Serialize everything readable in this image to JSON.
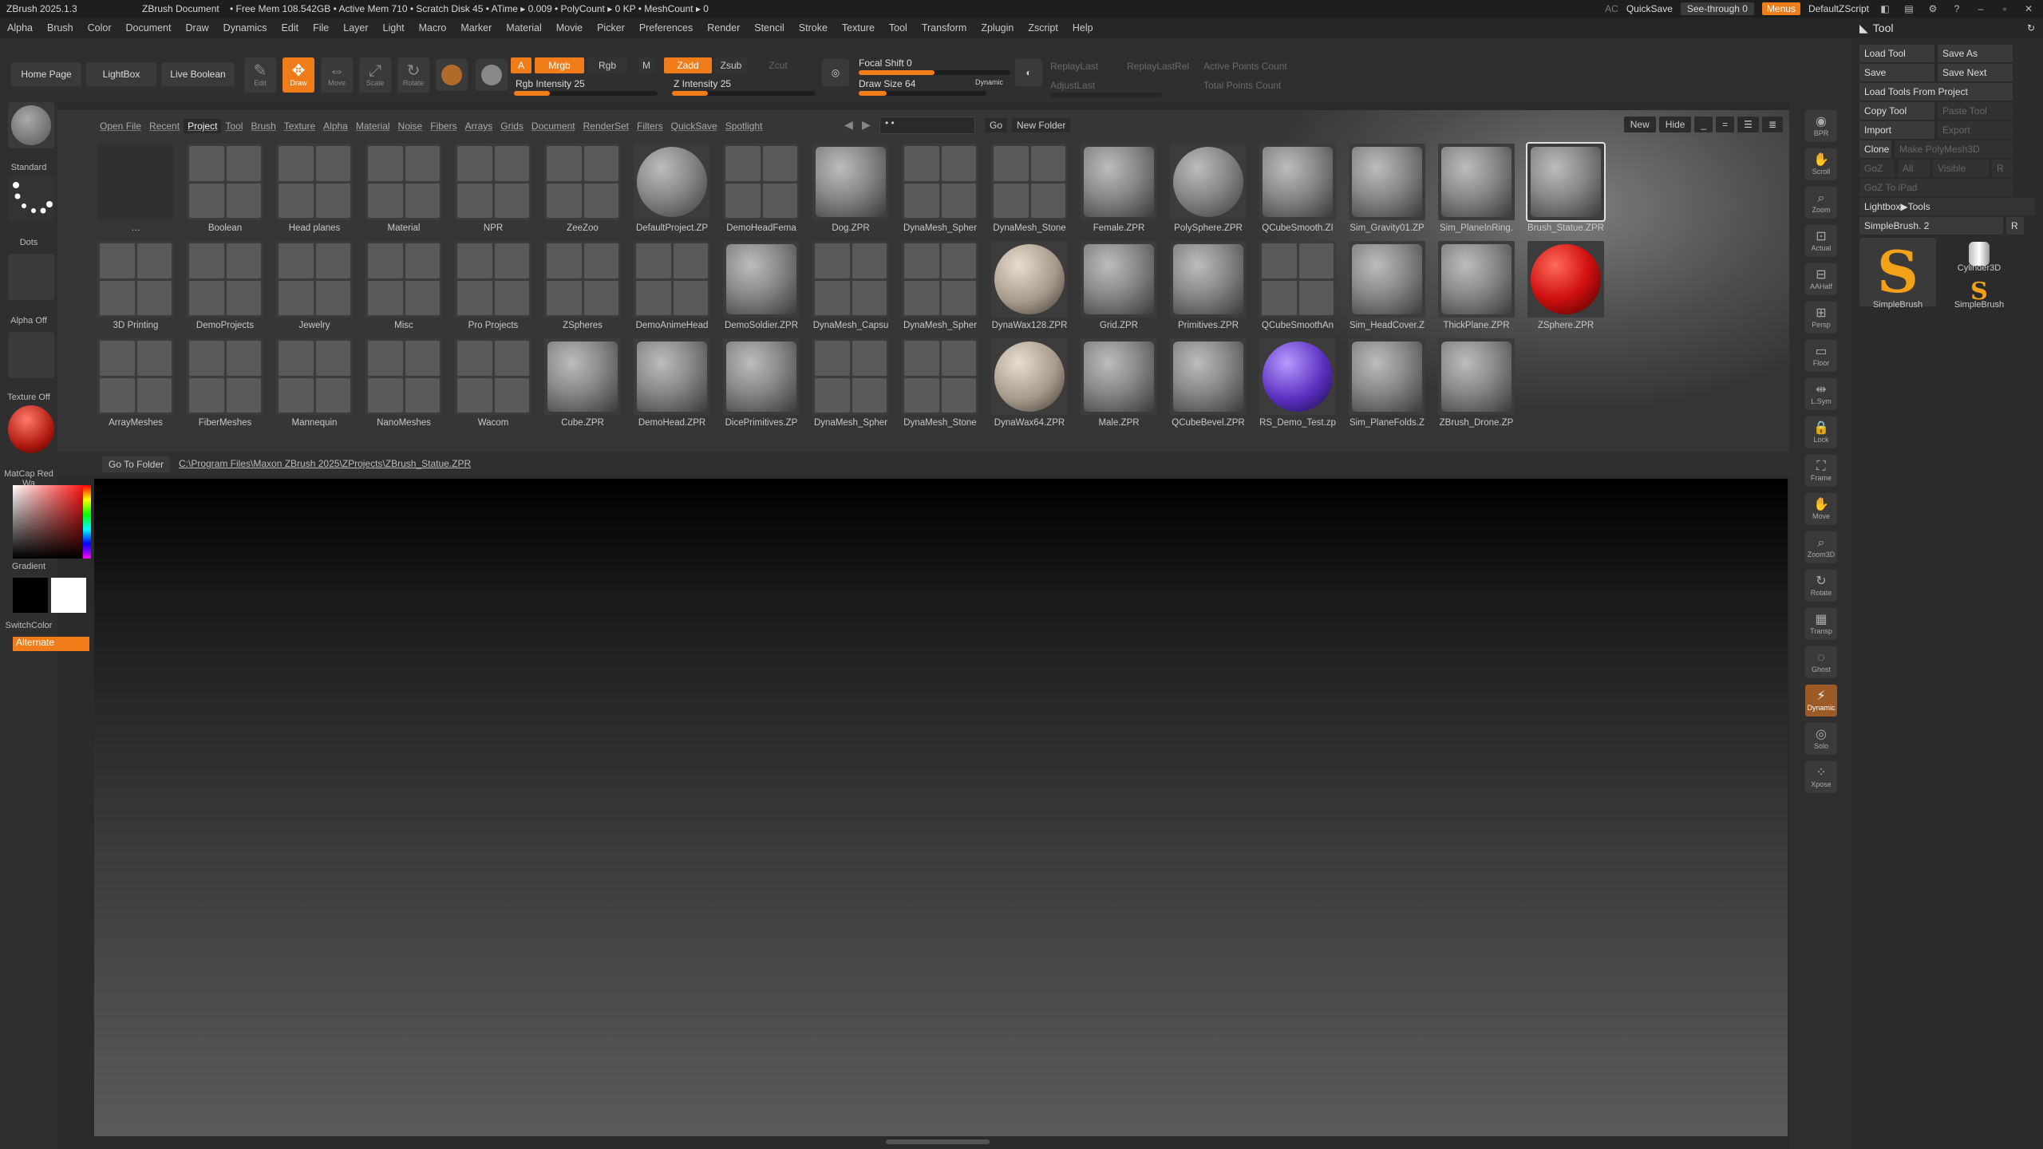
{
  "titlebar": {
    "app": "ZBrush 2025.1.3",
    "doc": "ZBrush Document",
    "stats": "• Free Mem 108.542GB • Active Mem 710 • Scratch Disk 45 • ATime ▸ 0.009 • PolyCount ▸ 0 KP • MeshCount ▸ 0",
    "ac": "AC",
    "quicksave": "QuickSave",
    "seethrough": "See-through  0",
    "menus": "Menus",
    "zscript": "DefaultZScript"
  },
  "menus": [
    "Alpha",
    "Brush",
    "Color",
    "Document",
    "Draw",
    "Dynamics",
    "Edit",
    "File",
    "Layer",
    "Light",
    "Macro",
    "Marker",
    "Material",
    "Movie",
    "Picker",
    "Preferences",
    "Render",
    "Stencil",
    "Stroke",
    "Texture",
    "Tool",
    "Transform",
    "Zplugin",
    "Zscript",
    "Help"
  ],
  "nav": {
    "home": "Home Page",
    "lightbox": "LightBox",
    "liveboolean": "Live Boolean"
  },
  "modes": [
    {
      "label": "Edit",
      "icon": "✎",
      "active": false
    },
    {
      "label": "Draw",
      "icon": "✥",
      "active": true
    },
    {
      "label": "Move",
      "icon": "⇔",
      "active": false
    },
    {
      "label": "Scale",
      "icon": "⤢",
      "active": false
    },
    {
      "label": "Rotate",
      "icon": "↻",
      "active": false
    }
  ],
  "shelf": {
    "a": "A",
    "mrgb": "Mrgb",
    "rgb": "Rgb",
    "m": "M",
    "zadd": "Zadd",
    "zsub": "Zsub",
    "zcut": "Zcut",
    "rgb_intensity": "Rgb Intensity 25",
    "rgb_intensity_value": 0.25,
    "z_intensity": "Z Intensity 25",
    "z_intensity_value": 0.25,
    "focal_shift": "Focal Shift 0",
    "focal_shift_value": 0.5,
    "draw_size": "Draw Size 64",
    "draw_size_value": 0.22,
    "dynamic": "Dynamic",
    "replaylast": "ReplayLast",
    "replaylastrel": "ReplayLastRel",
    "adjustlast": "AdjustLast",
    "active_points": "Active Points Count",
    "total_points": "Total Points Count"
  },
  "left": {
    "brush": "Standard",
    "stroke": "Dots",
    "alpha": "Alpha Off",
    "texture": "Texture Off",
    "material": "MatCap Red Wa",
    "gradient": "Gradient",
    "switchcolor": "SwitchColor",
    "alternate": "Alternate"
  },
  "lightbox": {
    "openfile": "Open File",
    "tabs": [
      "Recent",
      "Project",
      "Tool",
      "Brush",
      "Texture",
      "Alpha",
      "Material",
      "Noise",
      "Fibers",
      "Arrays",
      "Grids",
      "Document",
      "RenderSet",
      "Filters",
      "QuickSave",
      "Spotlight"
    ],
    "active_tab": "Project",
    "search_value": "• •",
    "go": "Go",
    "newfolder": "New Folder",
    "new": "New",
    "hide": "Hide",
    "gotofolder": "Go To Folder",
    "path": "C:\\Program Files\\Maxon ZBrush 2025\\ZProjects\\ZBrush_Statue.ZPR",
    "rows": [
      [
        "…",
        "Boolean",
        "Head planes",
        "Material",
        "NPR",
        "ZeeZoo",
        "DefaultProject.ZP",
        "DemoHeadFema",
        "Dog.ZPR",
        "DynaMesh_Spher",
        "DynaMesh_Stone",
        "Female.ZPR",
        "PolySphere.ZPR",
        "QCubeSmooth.ZI",
        "Sim_Gravity01.ZP",
        "Sim_PlaneInRing.",
        "Brush_Statue.ZPR"
      ],
      [
        "3D Printing",
        "DemoProjects",
        "Jewelry",
        "Misc",
        "Pro Projects",
        "ZSpheres",
        "DemoAnimeHead",
        "DemoSoldier.ZPR",
        "DynaMesh_Capsu",
        "DynaMesh_Spher",
        "DynaWax128.ZPR",
        "Grid.ZPR",
        "Primitives.ZPR",
        "QCubeSmoothAn",
        "Sim_HeadCover.Z",
        "ThickPlane.ZPR",
        "ZSphere.ZPR"
      ],
      [
        "ArrayMeshes",
        "FiberMeshes",
        "Mannequin",
        "NanoMeshes",
        "Wacom",
        "Cube.ZPR",
        "DemoHead.ZPR",
        "DicePrimitives.ZP",
        "DynaMesh_Spher",
        "DynaMesh_Stone",
        "DynaWax64.ZPR",
        "Male.ZPR",
        "QCubeBevel.ZPR",
        "RS_Demo_Test.zp",
        "Sim_PlaneFolds.Z",
        "ZBrush_Drone.ZP"
      ]
    ]
  },
  "rightshelf": [
    {
      "label": "BPR",
      "icon": "◉"
    },
    {
      "label": "Scroll",
      "icon": "✋"
    },
    {
      "label": "Zoom",
      "icon": "⌕"
    },
    {
      "label": "Actual",
      "icon": "⊡"
    },
    {
      "label": "AAHalf",
      "icon": "⊟"
    },
    {
      "label": "Persp",
      "icon": "⊞"
    },
    {
      "label": "Floor",
      "icon": "▭"
    },
    {
      "label": "L.Sym",
      "icon": "⇹"
    },
    {
      "label": "Lock",
      "icon": "🔒"
    },
    {
      "label": "Frame",
      "icon": "⛶"
    },
    {
      "label": "Move",
      "icon": "✋"
    },
    {
      "label": "Zoom3D",
      "icon": "⌕"
    },
    {
      "label": "Rotate",
      "icon": "↻"
    },
    {
      "label": "Transp",
      "icon": "▦"
    },
    {
      "label": "Ghost",
      "icon": "◌"
    },
    {
      "label": "Dynamic",
      "icon": "⚡"
    },
    {
      "label": "Solo",
      "icon": "◎"
    },
    {
      "label": "Xpose",
      "icon": "⁘"
    }
  ],
  "toolpanel": {
    "title": "Tool",
    "load_tool": "Load Tool",
    "save_as": "Save As",
    "save": "Save",
    "save_next": "Save Next",
    "load_from_project": "Load Tools From Project",
    "copy_tool": "Copy Tool",
    "paste_tool": "Paste Tool",
    "import": "Import",
    "export": "Export",
    "clone": "Clone",
    "make_polymesh": "Make PolyMesh3D",
    "goz": "GoZ",
    "all": "All",
    "visible": "Visible",
    "r": "R",
    "goz_to_pad": "GoZ To iPad",
    "lightbox_tools": "Lightbox▶Tools",
    "current_tool": "SimpleBrush. 2",
    "r2": "R",
    "thumb1": "SimpleBrush",
    "thumb2": "Cylinder3D",
    "thumb3": "SimpleBrush"
  },
  "colors": {
    "accent": "#f07c1a",
    "bg": "#2b2b2b"
  }
}
